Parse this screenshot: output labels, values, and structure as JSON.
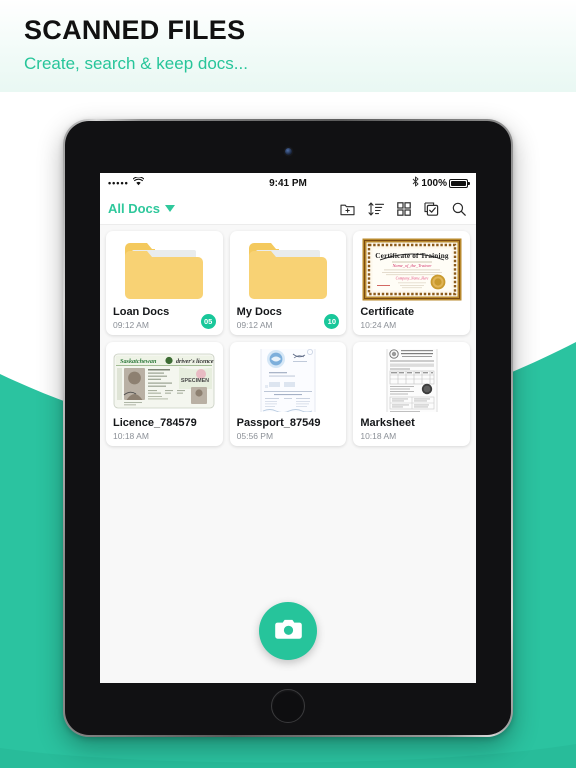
{
  "header": {
    "title": "SCANNED FILES",
    "subtitle": "Create, search & keep docs...",
    "accent_color": "#27c59a",
    "title_color": "#111111"
  },
  "theme": {
    "teal": "#26c49b",
    "band_color": "#2bc3a0",
    "badge_color": "#19c79a",
    "folder_color": "#f8d274"
  },
  "device": {
    "status_bar": {
      "signal_dots": "•••••",
      "wifi_icon": "wifi-icon",
      "time": "9:41 PM",
      "bluetooth_icon": "ᛗ",
      "battery_percent": "100%"
    },
    "toolbar": {
      "filter_label": "All Docs",
      "filter_caret": "chevron-down-icon",
      "actions": [
        {
          "name": "new-folder-icon",
          "label": "New Folder"
        },
        {
          "name": "sort-icon",
          "label": "Sort"
        },
        {
          "name": "grid-view-icon",
          "label": "Grid View"
        },
        {
          "name": "select-icon",
          "label": "Select"
        },
        {
          "name": "search-icon",
          "label": "Search"
        }
      ]
    },
    "fab": {
      "icon": "camera-icon",
      "label": "Scan"
    }
  },
  "files": {
    "rows": [
      [
        {
          "title": "Loan Docs",
          "time": "09:12 AM",
          "type": "folder",
          "badge": "05"
        },
        {
          "title": "My Docs",
          "time": "09:12 AM",
          "type": "folder",
          "badge": "10"
        },
        {
          "title": "Certificate",
          "time": "10:24 AM",
          "type": "certificate",
          "badge": ""
        }
      ],
      [
        {
          "title": "Licence_784579",
          "time": "10:18 AM",
          "type": "licence",
          "badge": ""
        },
        {
          "title": "Passport_87549",
          "time": "05:56 PM",
          "type": "passport",
          "badge": ""
        },
        {
          "title": "Marksheet",
          "time": "10:18 AM",
          "type": "marksheet",
          "badge": ""
        }
      ]
    ]
  },
  "thumbnails": {
    "certificate": {
      "heading": "Certificate of Training",
      "line_presented": "This certificate is presented to",
      "name": "Name_of_the_Trainee",
      "body": "who has completed the hours of course-hour training course and is awarded this certificate by",
      "company": "Company_Name_Here",
      "sig_labels": [
        "Company",
        "Trainer",
        "Director"
      ]
    },
    "licence": {
      "province": "Saskatchewan",
      "doc_type": "driver's licence",
      "watermark": "SPECIMEN"
    },
    "passport": {
      "label": "passport-document"
    },
    "marksheet": {
      "label": "marksheet-document"
    }
  }
}
